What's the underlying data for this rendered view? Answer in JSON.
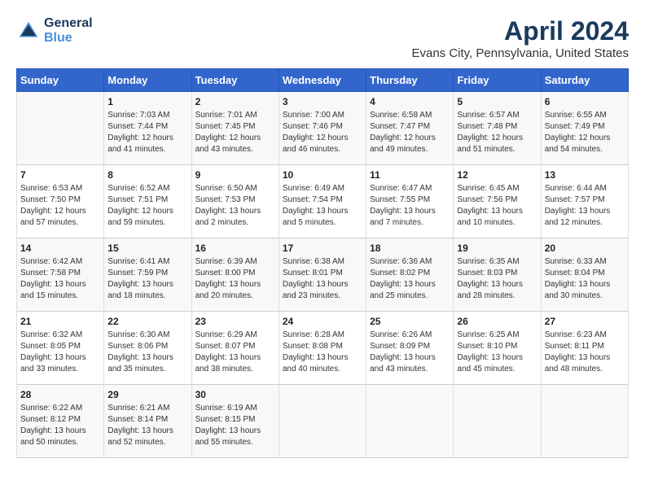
{
  "header": {
    "logo_line1": "General",
    "logo_line2": "Blue",
    "title": "April 2024",
    "subtitle": "Evans City, Pennsylvania, United States"
  },
  "days_of_week": [
    "Sunday",
    "Monday",
    "Tuesday",
    "Wednesday",
    "Thursday",
    "Friday",
    "Saturday"
  ],
  "weeks": [
    [
      {
        "day": "",
        "info": ""
      },
      {
        "day": "1",
        "info": "Sunrise: 7:03 AM\nSunset: 7:44 PM\nDaylight: 12 hours\nand 41 minutes."
      },
      {
        "day": "2",
        "info": "Sunrise: 7:01 AM\nSunset: 7:45 PM\nDaylight: 12 hours\nand 43 minutes."
      },
      {
        "day": "3",
        "info": "Sunrise: 7:00 AM\nSunset: 7:46 PM\nDaylight: 12 hours\nand 46 minutes."
      },
      {
        "day": "4",
        "info": "Sunrise: 6:58 AM\nSunset: 7:47 PM\nDaylight: 12 hours\nand 49 minutes."
      },
      {
        "day": "5",
        "info": "Sunrise: 6:57 AM\nSunset: 7:48 PM\nDaylight: 12 hours\nand 51 minutes."
      },
      {
        "day": "6",
        "info": "Sunrise: 6:55 AM\nSunset: 7:49 PM\nDaylight: 12 hours\nand 54 minutes."
      }
    ],
    [
      {
        "day": "7",
        "info": "Sunrise: 6:53 AM\nSunset: 7:50 PM\nDaylight: 12 hours\nand 57 minutes."
      },
      {
        "day": "8",
        "info": "Sunrise: 6:52 AM\nSunset: 7:51 PM\nDaylight: 12 hours\nand 59 minutes."
      },
      {
        "day": "9",
        "info": "Sunrise: 6:50 AM\nSunset: 7:53 PM\nDaylight: 13 hours\nand 2 minutes."
      },
      {
        "day": "10",
        "info": "Sunrise: 6:49 AM\nSunset: 7:54 PM\nDaylight: 13 hours\nand 5 minutes."
      },
      {
        "day": "11",
        "info": "Sunrise: 6:47 AM\nSunset: 7:55 PM\nDaylight: 13 hours\nand 7 minutes."
      },
      {
        "day": "12",
        "info": "Sunrise: 6:45 AM\nSunset: 7:56 PM\nDaylight: 13 hours\nand 10 minutes."
      },
      {
        "day": "13",
        "info": "Sunrise: 6:44 AM\nSunset: 7:57 PM\nDaylight: 13 hours\nand 12 minutes."
      }
    ],
    [
      {
        "day": "14",
        "info": "Sunrise: 6:42 AM\nSunset: 7:58 PM\nDaylight: 13 hours\nand 15 minutes."
      },
      {
        "day": "15",
        "info": "Sunrise: 6:41 AM\nSunset: 7:59 PM\nDaylight: 13 hours\nand 18 minutes."
      },
      {
        "day": "16",
        "info": "Sunrise: 6:39 AM\nSunset: 8:00 PM\nDaylight: 13 hours\nand 20 minutes."
      },
      {
        "day": "17",
        "info": "Sunrise: 6:38 AM\nSunset: 8:01 PM\nDaylight: 13 hours\nand 23 minutes."
      },
      {
        "day": "18",
        "info": "Sunrise: 6:36 AM\nSunset: 8:02 PM\nDaylight: 13 hours\nand 25 minutes."
      },
      {
        "day": "19",
        "info": "Sunrise: 6:35 AM\nSunset: 8:03 PM\nDaylight: 13 hours\nand 28 minutes."
      },
      {
        "day": "20",
        "info": "Sunrise: 6:33 AM\nSunset: 8:04 PM\nDaylight: 13 hours\nand 30 minutes."
      }
    ],
    [
      {
        "day": "21",
        "info": "Sunrise: 6:32 AM\nSunset: 8:05 PM\nDaylight: 13 hours\nand 33 minutes."
      },
      {
        "day": "22",
        "info": "Sunrise: 6:30 AM\nSunset: 8:06 PM\nDaylight: 13 hours\nand 35 minutes."
      },
      {
        "day": "23",
        "info": "Sunrise: 6:29 AM\nSunset: 8:07 PM\nDaylight: 13 hours\nand 38 minutes."
      },
      {
        "day": "24",
        "info": "Sunrise: 6:28 AM\nSunset: 8:08 PM\nDaylight: 13 hours\nand 40 minutes."
      },
      {
        "day": "25",
        "info": "Sunrise: 6:26 AM\nSunset: 8:09 PM\nDaylight: 13 hours\nand 43 minutes."
      },
      {
        "day": "26",
        "info": "Sunrise: 6:25 AM\nSunset: 8:10 PM\nDaylight: 13 hours\nand 45 minutes."
      },
      {
        "day": "27",
        "info": "Sunrise: 6:23 AM\nSunset: 8:11 PM\nDaylight: 13 hours\nand 48 minutes."
      }
    ],
    [
      {
        "day": "28",
        "info": "Sunrise: 6:22 AM\nSunset: 8:12 PM\nDaylight: 13 hours\nand 50 minutes."
      },
      {
        "day": "29",
        "info": "Sunrise: 6:21 AM\nSunset: 8:14 PM\nDaylight: 13 hours\nand 52 minutes."
      },
      {
        "day": "30",
        "info": "Sunrise: 6:19 AM\nSunset: 8:15 PM\nDaylight: 13 hours\nand 55 minutes."
      },
      {
        "day": "",
        "info": ""
      },
      {
        "day": "",
        "info": ""
      },
      {
        "day": "",
        "info": ""
      },
      {
        "day": "",
        "info": ""
      }
    ]
  ]
}
